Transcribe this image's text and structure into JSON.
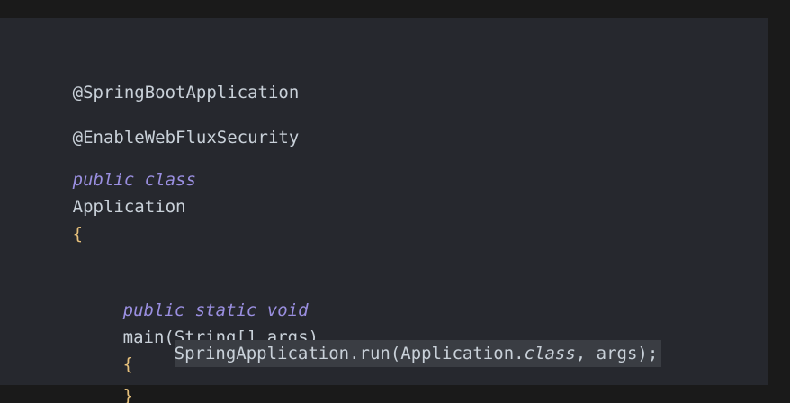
{
  "code": {
    "line1": "@SpringBootApplication",
    "line2": "@EnableWebFluxSecurity",
    "line3": {
      "kw": "public class",
      "name": "Application",
      "brace": "{"
    },
    "line4": {
      "kw": "public static void",
      "sig": "main(String[] args)",
      "brace": "{"
    },
    "line5": {
      "pre": "SpringApplication.run(Application.",
      "class_kw": "class",
      "post": ", args);"
    },
    "line6": {
      "brace": "}"
    }
  },
  "colors": {
    "background": "#1a1a1a",
    "editor": "#26282e",
    "keyword": "#9a8fe0",
    "text": "#c9d1d9",
    "highlight": "#3a3d43",
    "brace": "#e6c07b"
  }
}
